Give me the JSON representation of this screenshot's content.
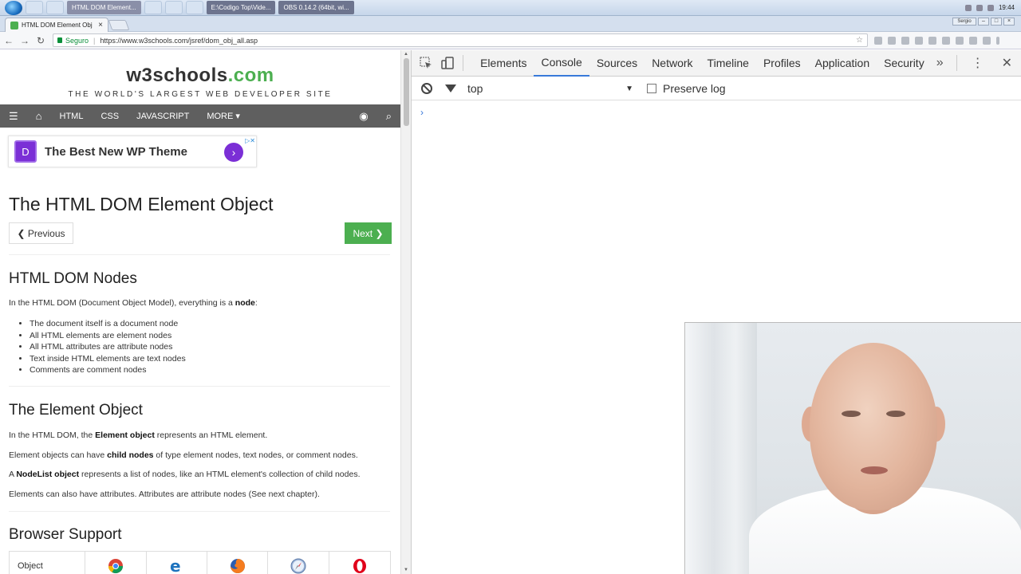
{
  "taskbar": {
    "tasks": [
      {
        "label": "HTML DOM Element...",
        "type": "active"
      },
      {
        "label": "E:\\Codigo Top\\Vide...",
        "type": "other"
      },
      {
        "label": "OBS 0.14.2 (64bit, wi...",
        "type": "other"
      }
    ],
    "clock": "19:44"
  },
  "browser": {
    "tab_title": "HTML DOM Element Obj",
    "tab_close": "×",
    "user_chip": "Sergio",
    "secure_label": "Seguro",
    "url": "https://www.w3schools.com/jsref/dom_obj_all.asp",
    "star": "☆"
  },
  "site": {
    "logo_main": "w3schools",
    "logo_suffix": ".com",
    "tagline": "THE WORLD'S LARGEST WEB DEVELOPER SITE",
    "nav": {
      "menu_icon": "☰",
      "home_icon": "⌂",
      "items": [
        "HTML",
        "CSS",
        "JAVASCRIPT",
        "MORE ▾"
      ],
      "globe_icon": "◉",
      "search_icon": "⌕"
    },
    "ad": {
      "logo": "D",
      "text": "The Best New WP Theme",
      "go": "›",
      "close": "▷✕"
    },
    "title": "The HTML DOM Element Object",
    "prev": "❮ Previous",
    "next": "Next ❯",
    "section1": {
      "heading": "HTML DOM Nodes",
      "intro_a": "In the HTML DOM (Document Object Model), everything is a ",
      "intro_b": "node",
      "intro_c": ":",
      "items": [
        "The document itself is a document node",
        "All HTML elements are element nodes",
        "All HTML attributes are attribute nodes",
        "Text inside HTML elements are text nodes",
        "Comments are comment nodes"
      ]
    },
    "section2": {
      "heading": "The Element Object",
      "p1a": "In the HTML DOM, the ",
      "p1b": "Element object",
      "p1c": " represents an HTML element.",
      "p2a": "Element objects can have ",
      "p2b": "child nodes",
      "p2c": " of type element nodes, text nodes, or comment nodes.",
      "p3a": "A ",
      "p3b": "NodeList object",
      "p3c": " represents a list of nodes, like an HTML element's collection of child nodes.",
      "p4": "Elements can also have attributes. Attributes are attribute nodes (See next chapter)."
    },
    "section3": {
      "heading": "Browser Support",
      "col_object": "Object",
      "browsers": [
        "chrome",
        "edge",
        "firefox",
        "safari",
        "opera"
      ]
    }
  },
  "devtools": {
    "tabs": [
      "Elements",
      "Console",
      "Sources",
      "Network",
      "Timeline",
      "Profiles",
      "Application",
      "Security"
    ],
    "active_tab": "Console",
    "more": "»",
    "menu": "⋮",
    "close": "✕",
    "context": "top",
    "context_arrow": "▼",
    "preserve_log": "Preserve log",
    "prompt": "›"
  }
}
